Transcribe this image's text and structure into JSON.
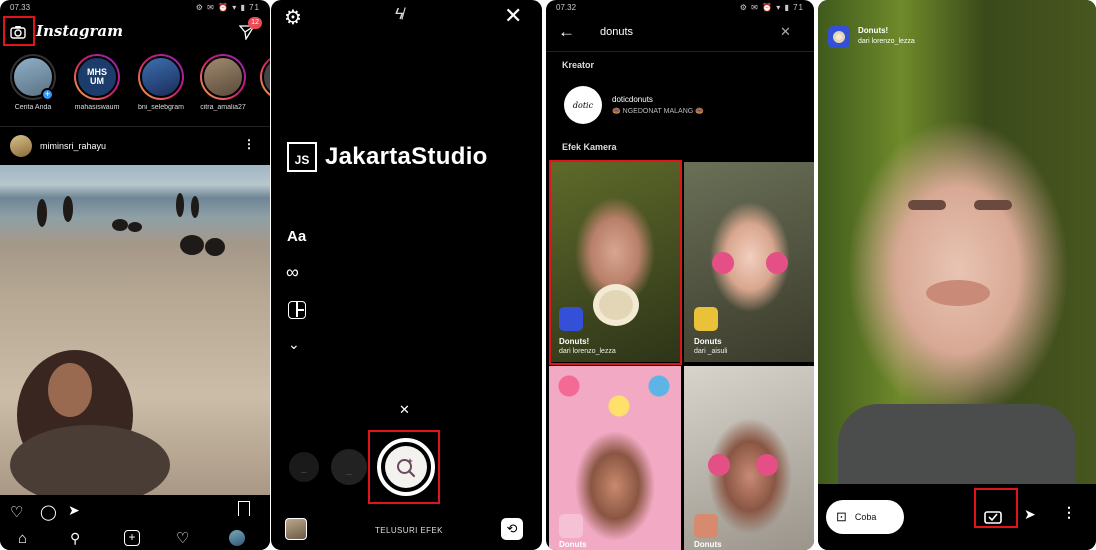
{
  "panel1": {
    "status_time": "07.33",
    "status_icons": "⚙ ✉ ⏰ ▾ ▮ 71",
    "app_logo": "Instagram",
    "dm_badge": "12",
    "stories": [
      {
        "name": "Cerita Anda"
      },
      {
        "name": "mahasiswaum"
      },
      {
        "name": "bni_selebgram"
      },
      {
        "name": "citra_amalia27"
      }
    ],
    "post_username": "miminsri_rahayu",
    "colors": {
      "highlight": "#e0151b",
      "badge": "#ed4956"
    }
  },
  "panel2": {
    "watermark_initials": "JS",
    "watermark_text": "JakartaStudio",
    "text_tool": "Aa",
    "browse_label": "TELUSURI EFEK"
  },
  "panel3": {
    "status_time": "07.32",
    "status_icons": "⚙ ✉ ⏰ ▾ ▮ 71",
    "search_query": "donuts",
    "section_creator": "Kreator",
    "creator_name": "doticdonuts",
    "creator_subtitle": "🍩 NGEDONAT MALANG 🍩",
    "section_effects": "Efek Kamera",
    "effects": [
      {
        "name": "Donuts!",
        "by": "dari lorenzo_lezza"
      },
      {
        "name": "Donuts",
        "by": "dari _aisuli"
      },
      {
        "name": "Donuts",
        "by": ""
      },
      {
        "name": "Donuts",
        "by": ""
      }
    ]
  },
  "panel4": {
    "effect_name": "Donuts!",
    "effect_by": "dari lorenzo_lezza",
    "try_label": "Coba"
  }
}
